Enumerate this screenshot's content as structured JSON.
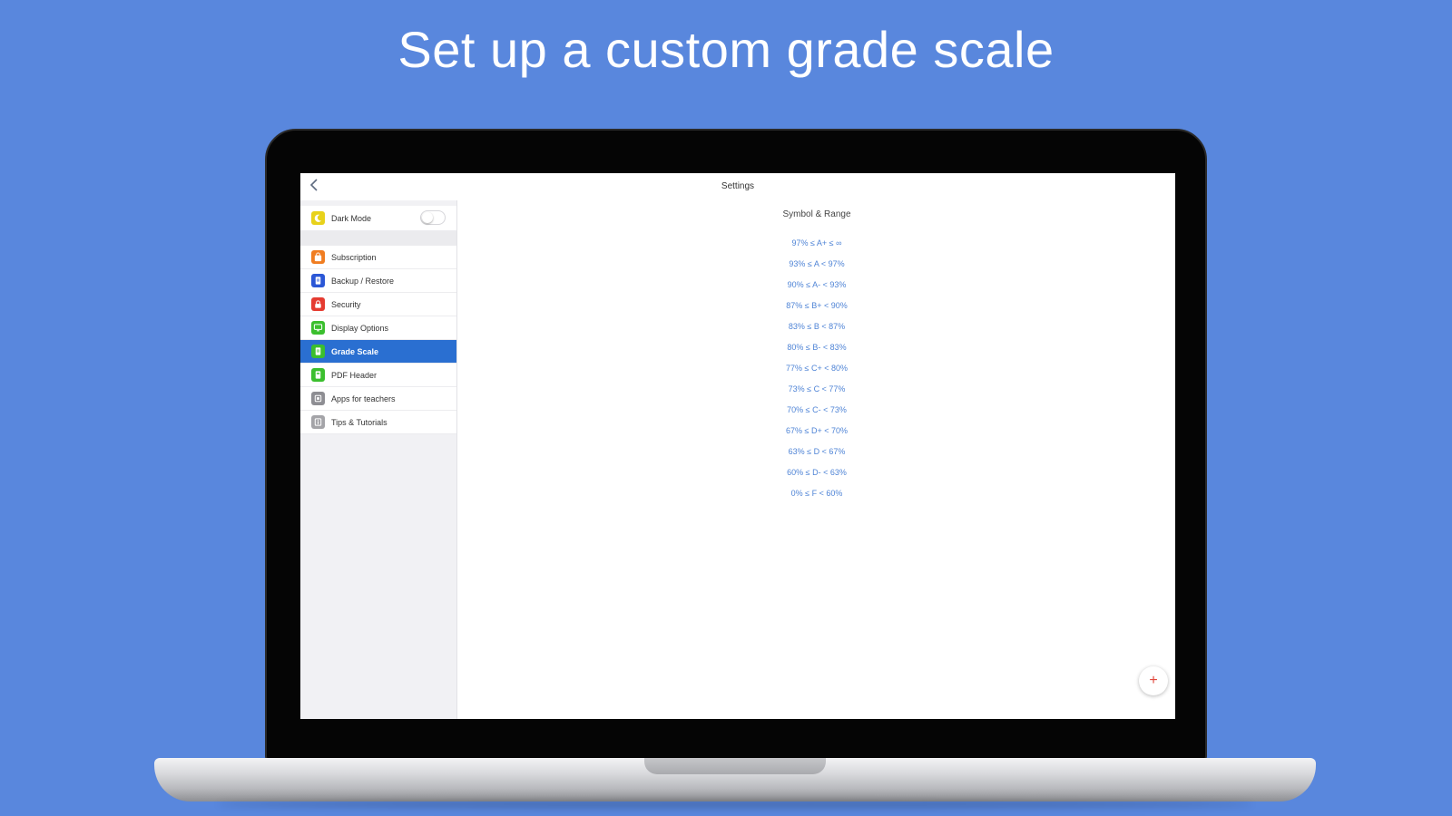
{
  "headline": "Set up a custom grade scale",
  "topbar": {
    "back_icon": "chevron-left-icon",
    "title": "Settings"
  },
  "sidebar": {
    "dark_mode": {
      "label": "Dark Mode",
      "icon": "moon-icon",
      "color": "#e8d21b",
      "enabled": false
    },
    "items": [
      {
        "label": "Subscription",
        "icon": "bag-icon",
        "color": "#f07d21"
      },
      {
        "label": "Backup / Restore",
        "icon": "document-icon",
        "color": "#2b57d6"
      },
      {
        "label": "Security",
        "icon": "lock-icon",
        "color": "#e53b31"
      },
      {
        "label": "Display Options",
        "icon": "monitor-icon",
        "color": "#3bbf2e"
      },
      {
        "label": "Grade Scale",
        "icon": "grade-sheet-icon",
        "color": "#3bbf2e",
        "active": true
      },
      {
        "label": "PDF Header",
        "icon": "pdf-icon",
        "color": "#3bbf2e"
      },
      {
        "label": "Apps for teachers",
        "icon": "apps-icon",
        "color": "#8e8e93"
      },
      {
        "label": "Tips & Tutorials",
        "icon": "info-icon",
        "color": "#a4a4a8"
      }
    ]
  },
  "content": {
    "section_title": "Symbol & Range",
    "grade_scale": [
      "97% ≤ A+ ≤ ∞",
      "93% ≤ A < 97%",
      "90% ≤ A- < 93%",
      "87% ≤ B+ < 90%",
      "83% ≤ B < 87%",
      "80% ≤ B- < 83%",
      "77% ≤ C+ < 80%",
      "73% ≤ C < 77%",
      "70% ≤ C- < 73%",
      "67% ≤ D+ < 70%",
      "63% ≤ D < 67%",
      "60% ≤ D- < 63%",
      "0% ≤ F < 60%"
    ],
    "add_button": "+"
  },
  "colors": {
    "background": "#5987dd",
    "accent": "#2a6fd1",
    "scale_text": "#4f84d6",
    "add_icon": "#e0453a"
  }
}
